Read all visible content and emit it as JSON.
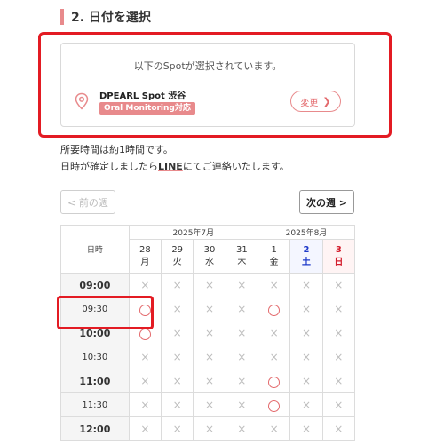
{
  "step": {
    "title": "2. 日付を選択"
  },
  "spot": {
    "message": "以下のSpotが選択されています。",
    "name": "DPEARL Spot 渋谷",
    "badge": "Oral Monitoring対応",
    "change_label": "変更",
    "icon": "map-pin-icon"
  },
  "info": {
    "duration": "所要時間は約1時間です。",
    "confirm_before": "日時が確定しましたら",
    "confirm_line": "LINE",
    "confirm_after": "にてご連絡いたします。"
  },
  "nav": {
    "prev_week": "< 前の週",
    "next_week": "次の週 >"
  },
  "calendar": {
    "label_header": "日時",
    "months": [
      "2025年7月",
      "2025年8月"
    ],
    "days": [
      {
        "date": "28",
        "weekday": "月"
      },
      {
        "date": "29",
        "weekday": "火"
      },
      {
        "date": "30",
        "weekday": "水"
      },
      {
        "date": "31",
        "weekday": "木"
      },
      {
        "date": "1",
        "weekday": "金"
      },
      {
        "date": "2",
        "weekday": "土"
      },
      {
        "date": "3",
        "weekday": "日"
      }
    ],
    "times": [
      "09:00",
      "09:30",
      "10:00",
      "10:30",
      "11:00",
      "11:30",
      "12:00"
    ],
    "available_symbol": "○",
    "unavailable_symbol": "×",
    "availability": [
      [
        "x",
        "x",
        "x",
        "x",
        "x",
        "x",
        "x"
      ],
      [
        "o",
        "x",
        "x",
        "x",
        "o",
        "x",
        "x"
      ],
      [
        "o",
        "x",
        "x",
        "x",
        "x",
        "x",
        "x"
      ],
      [
        "x",
        "x",
        "x",
        "x",
        "x",
        "x",
        "x"
      ],
      [
        "x",
        "x",
        "x",
        "x",
        "o",
        "x",
        "x"
      ],
      [
        "x",
        "x",
        "x",
        "x",
        "o",
        "x",
        "x"
      ],
      [
        "x",
        "x",
        "x",
        "x",
        "x",
        "x",
        "x"
      ]
    ],
    "colors": {
      "saturday": "#1d39c9",
      "sunday": "#d31d2c",
      "accent": "#e88a8c",
      "highlight": "#e31b23"
    }
  }
}
